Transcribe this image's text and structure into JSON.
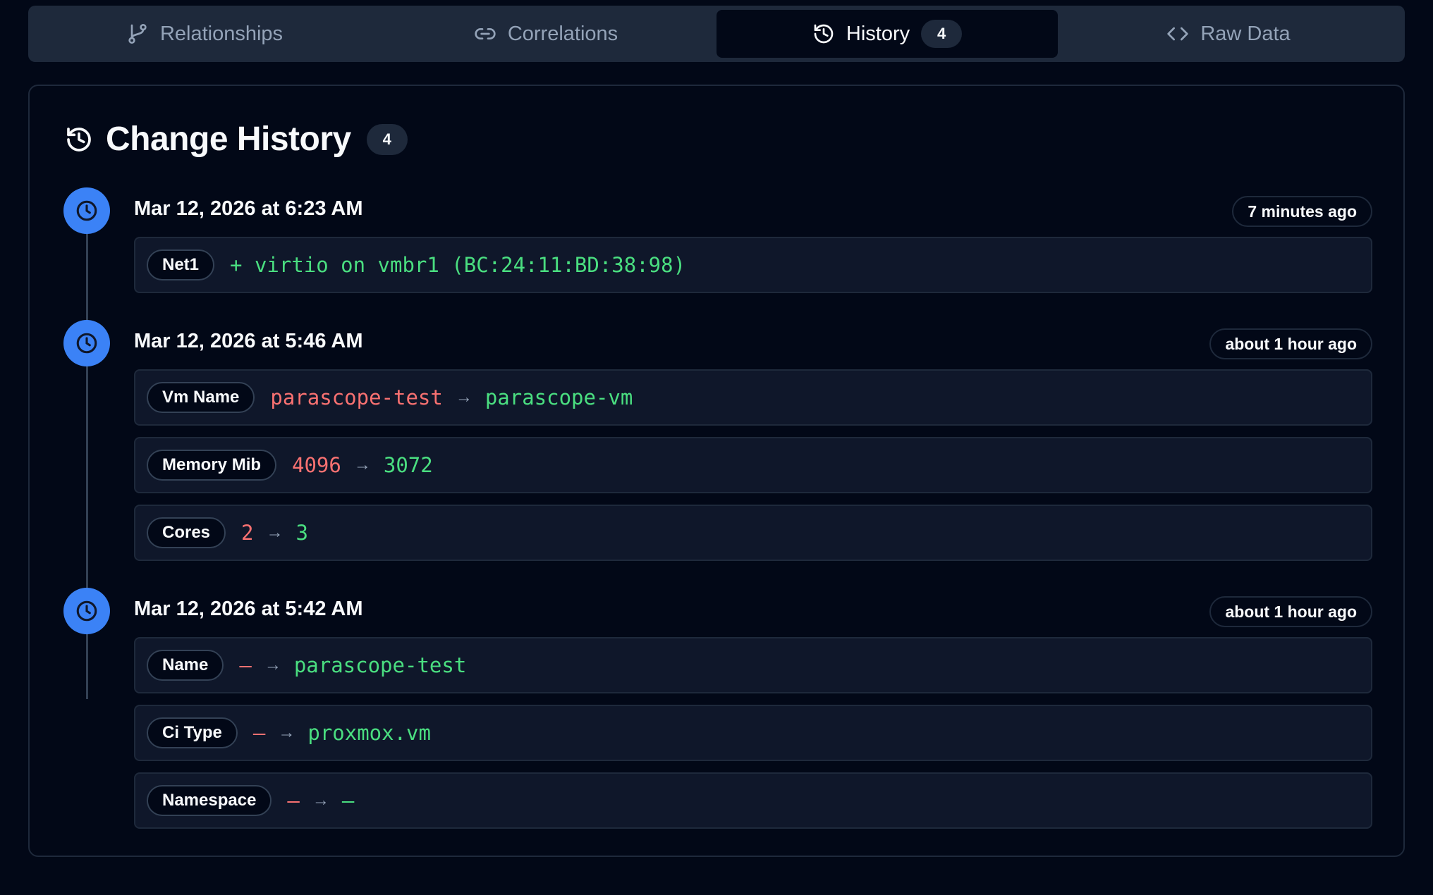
{
  "tabs": [
    {
      "label": "Relationships",
      "icon": "git-branch-icon"
    },
    {
      "label": "Correlations",
      "icon": "link-icon"
    },
    {
      "label": "History",
      "icon": "history-icon",
      "count": "4",
      "active": true
    },
    {
      "label": "Raw Data",
      "icon": "code-icon"
    }
  ],
  "header": {
    "title": "Change History",
    "count": "4"
  },
  "arrow": "→",
  "entries": [
    {
      "date": "Mar 12, 2026 at 6:23 AM",
      "ago": "7 minutes ago",
      "changes": [
        {
          "field": "Net1",
          "added": "+ virtio on vmbr1 (BC:24:11:BD:38:98)"
        }
      ]
    },
    {
      "date": "Mar 12, 2026 at 5:46 AM",
      "ago": "about 1 hour ago",
      "changes": [
        {
          "field": "Vm Name",
          "old": "parascope-test",
          "new": "parascope-vm"
        },
        {
          "field": "Memory Mib",
          "old": "4096",
          "new": "3072"
        },
        {
          "field": "Cores",
          "old": "2",
          "new": "3"
        }
      ]
    },
    {
      "date": "Mar 12, 2026 at 5:42 AM",
      "ago": "about 1 hour ago",
      "changes": [
        {
          "field": "Name",
          "old": "—",
          "new": "parascope-test"
        },
        {
          "field": "Ci Type",
          "old": "—",
          "new": "proxmox.vm"
        },
        {
          "field": "Namespace",
          "old": "—",
          "new": "—"
        }
      ]
    }
  ],
  "colors": {
    "accent": "#3b82f6",
    "old": "#f87171",
    "new": "#4ade80",
    "background": "#020817"
  }
}
